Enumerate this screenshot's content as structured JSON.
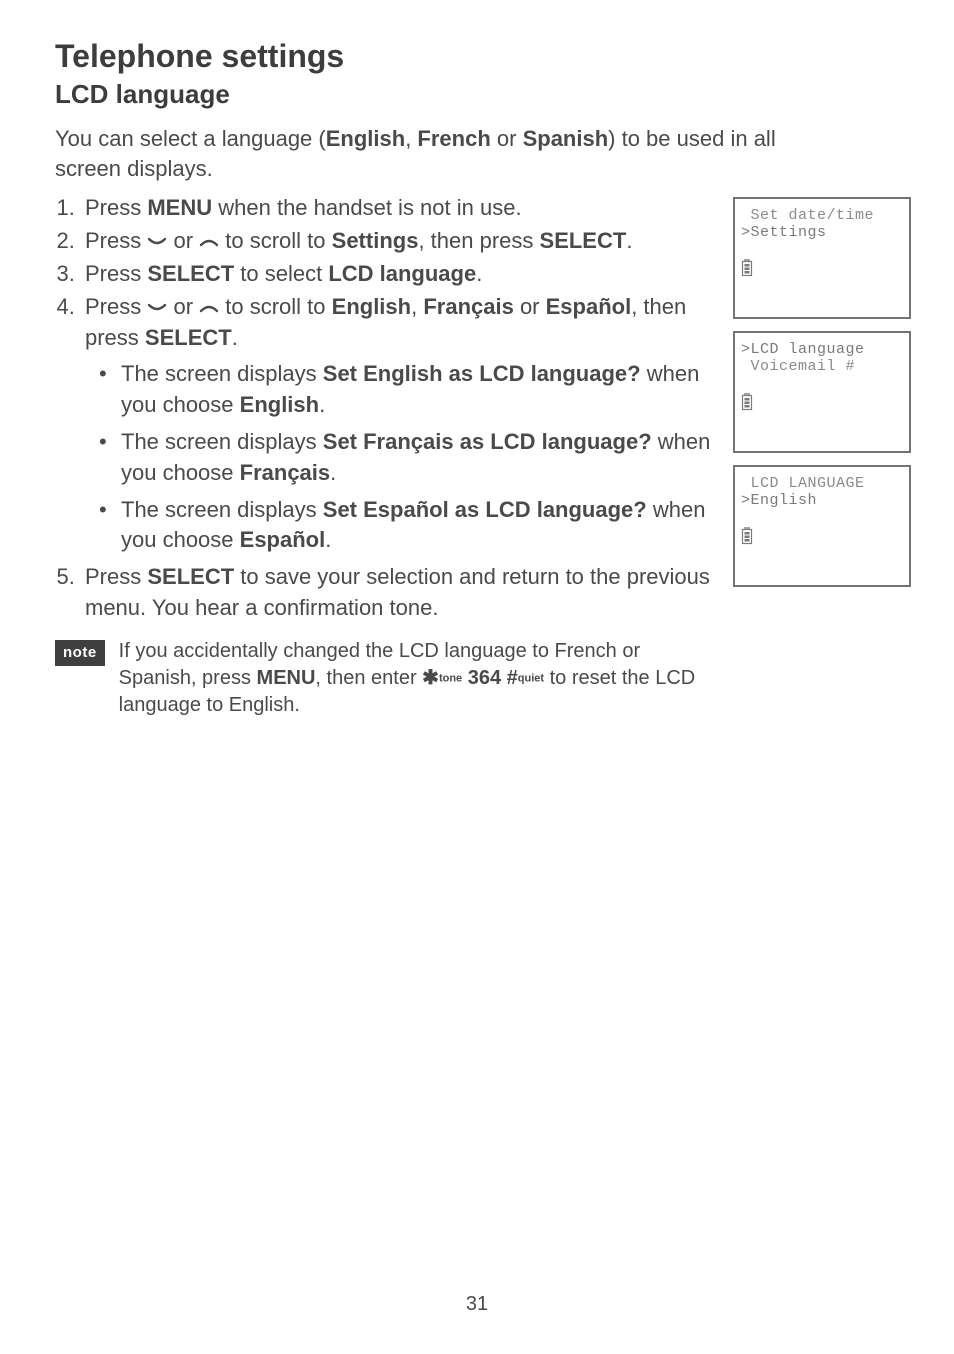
{
  "heading": "Telephone settings",
  "subheading": "LCD language",
  "intro_pre": "You can select a language (",
  "intro_lang1": "English",
  "intro_mid1": ", ",
  "intro_lang2": "French",
  "intro_mid2": " or ",
  "intro_lang3": "Spanish",
  "intro_post": ") to be used in all screen displays.",
  "steps": {
    "s1_a": "Press ",
    "s1_b": "MENU",
    "s1_c": " when the handset is not in use.",
    "s2_a": "Press ",
    "s2_b": " or ",
    "s2_c": " to scroll to ",
    "s2_d": "Settings",
    "s2_e": ", then press ",
    "s2_f": "SELECT",
    "s2_g": ".",
    "s3_a": "Press ",
    "s3_b": "SELECT",
    "s3_c": " to select ",
    "s3_d": "LCD language",
    "s3_e": ".",
    "s4_a": "Press ",
    "s4_b": " or ",
    "s4_c": " to scroll to ",
    "s4_d": "English",
    "s4_e": ", ",
    "s4_f": "Français",
    "s4_g": " or ",
    "s4_h": "Español",
    "s4_i": ", then press ",
    "s4_j": "SELECT",
    "s4_k": ".",
    "b1_a": "The screen displays ",
    "b1_b": "Set English as LCD language?",
    "b1_c": " when you choose ",
    "b1_d": "English",
    "b1_e": ".",
    "b2_a": "The screen displays ",
    "b2_b": "Set Français as LCD language?",
    "b2_c": " when you choose ",
    "b2_d": "Français",
    "b2_e": ".",
    "b3_a": "The screen displays ",
    "b3_b": "Set Español as LCD language?",
    "b3_c": " when you choose ",
    "b3_d": "Español",
    "b3_e": ".",
    "s5_a": "Press ",
    "s5_b": "SELECT",
    "s5_c": " to save your selection and return to the previous menu. You hear a confirmation tone."
  },
  "note_label": "note",
  "note_a": "If you accidentally changed the LCD language to French or Spanish, press ",
  "note_b": "MENU",
  "note_c": ", then enter ",
  "note_star": "✱",
  "note_tone": "tone",
  "note_d": " 364 ",
  "note_hash": "#",
  "note_quiet": "quiet",
  "note_e": " to reset the LCD language to English.",
  "screens": {
    "a1": " Set date/time",
    "a2": ">Settings",
    "b1": ">LCD language",
    "b2": " Voicemail #",
    "c1": " LCD LANGUAGE",
    "c2": ">English"
  },
  "page_number": "31"
}
